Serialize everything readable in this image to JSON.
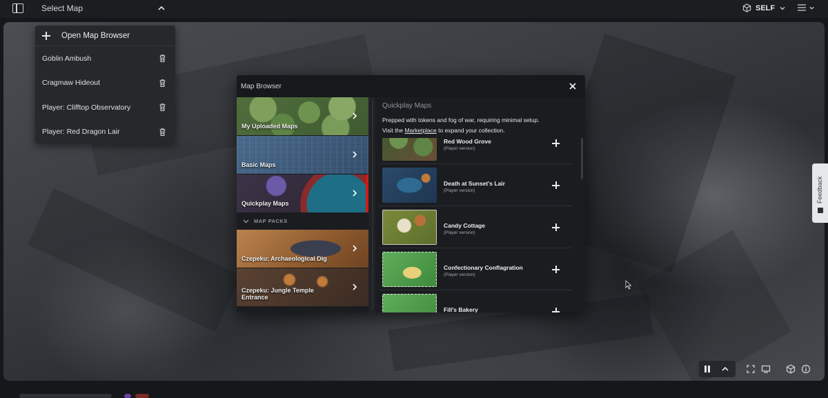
{
  "topbar": {
    "select_map_label": "Select Map",
    "view_mode": "SELF"
  },
  "map_dropdown": {
    "open_browser_label": "Open Map Browser",
    "items": [
      {
        "label": "Goblin Ambush"
      },
      {
        "label": "Cragmaw Hideout"
      },
      {
        "label": "Player: Clifftop Observatory"
      },
      {
        "label": "Player: Red Dragon Lair"
      }
    ]
  },
  "map_browser": {
    "title": "Map Browser",
    "categories": [
      {
        "label": "My Uploaded Maps"
      },
      {
        "label": "Basic Maps"
      },
      {
        "label": "Quickplay Maps"
      }
    ],
    "map_packs_label": "MAP PACKS",
    "packs": [
      {
        "label": "Czepeku: Archaeological Dig"
      },
      {
        "label": "Czepeku: Jungle Temple Entrance"
      }
    ],
    "quickplay": {
      "heading": "Quickplay Maps",
      "desc_line1": "Prepped with tokens and fog of war, requiring minimal setup.",
      "desc_visit": "Visit the",
      "marketplace_link": "Marketplace",
      "desc_rest": "to expand your collection.",
      "items": [
        {
          "name": "Red Wood Grove",
          "subtitle": "(Player version)"
        },
        {
          "name": "Death at Sunset's Lair",
          "subtitle": "(Player version)"
        },
        {
          "name": "Candy Cottage",
          "subtitle": "(Player version)"
        },
        {
          "name": "Confectionary Conflagration",
          "subtitle": "(Player version)"
        },
        {
          "name": "Fill's Bakery",
          "subtitle": ""
        }
      ]
    }
  },
  "feedback_label": "Feedback",
  "colors": {
    "accent_red": "#d11a1a",
    "panel_bg": "#1a1c20",
    "topbar_bg": "#1b1d21"
  }
}
